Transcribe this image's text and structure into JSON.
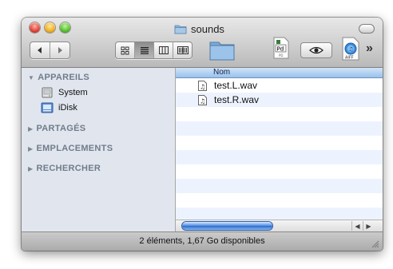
{
  "window": {
    "title": "sounds"
  },
  "toolbar": {
    "back_icon": "back-arrow-icon",
    "forward_icon": "forward-arrow-icon",
    "view_modes": [
      "icon-view",
      "list-view",
      "column-view",
      "cover-flow-view"
    ],
    "active_view": "list-view",
    "pd_label": "Pd",
    "aiff_label": "AIFF",
    "more_label": "»"
  },
  "sidebar": {
    "sections": [
      {
        "title": "APPAREILS",
        "expanded": true,
        "items": [
          {
            "label": "System",
            "icon": "hard-disk-icon"
          },
          {
            "label": "iDisk",
            "icon": "idisk-icon"
          }
        ]
      },
      {
        "title": "PARTAGÉS",
        "expanded": false,
        "items": []
      },
      {
        "title": "EMPLACEMENTS",
        "expanded": false,
        "items": []
      },
      {
        "title": "RECHERCHER",
        "expanded": false,
        "items": []
      }
    ]
  },
  "list": {
    "column_header": "Nom",
    "files": [
      {
        "name": "test.L.wav"
      },
      {
        "name": "test.R.wav"
      }
    ]
  },
  "status": {
    "text": "2 éléments, 1,67 Go disponibles"
  },
  "colors": {
    "selection_header": "#98c0ec",
    "sidebar_bg": "#e1e6ee",
    "row_stripe": "#edf3fe"
  }
}
